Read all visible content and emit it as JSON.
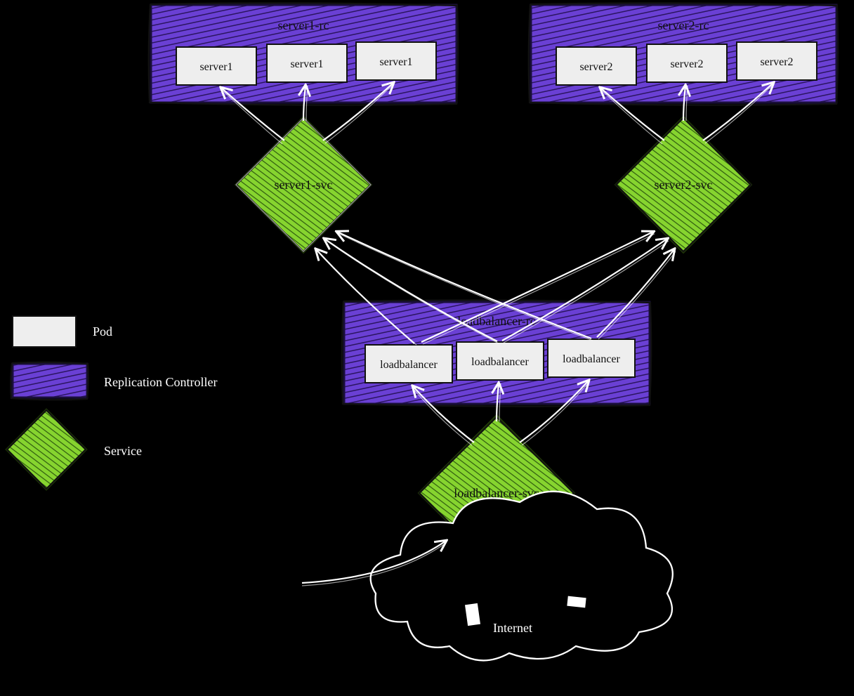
{
  "rc1": {
    "title": "server1-rc",
    "pods": [
      "server1",
      "server1",
      "server1"
    ]
  },
  "rc2": {
    "title": "server2-rc",
    "pods": [
      "server2",
      "server2",
      "server2"
    ]
  },
  "svc1": "server1-svc",
  "svc2": "server2-svc",
  "rc3": {
    "title": "loadbalancer-rc",
    "pods": [
      "loadbalancer",
      "loadbalancer",
      "loadbalancer"
    ]
  },
  "svc3": "loadbalancer-svc",
  "legend": {
    "pod": "Pod",
    "rc": "Replication Controller",
    "svc": "Service"
  },
  "footer": "Internet"
}
